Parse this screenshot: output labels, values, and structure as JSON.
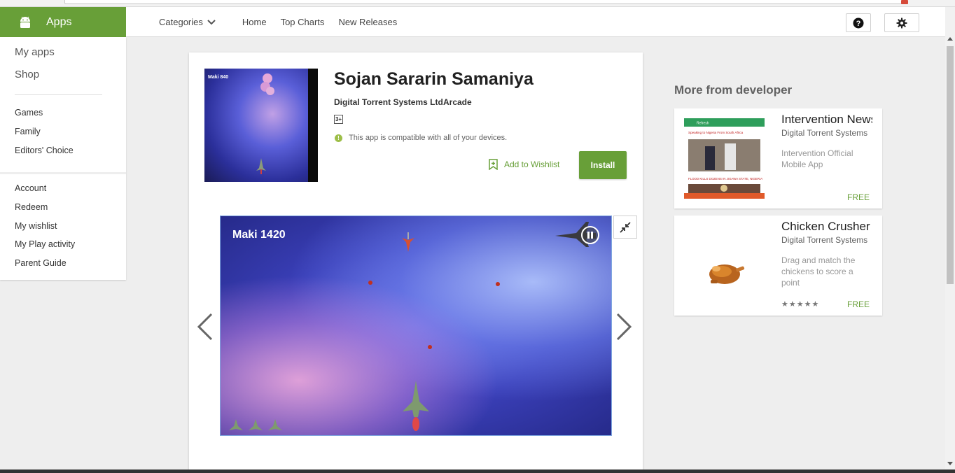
{
  "header": {
    "brand_label": "Apps",
    "nav": {
      "categories_label": "Categories",
      "home_label": "Home",
      "top_charts_label": "Top Charts",
      "new_releases_label": "New Releases"
    }
  },
  "sidebar": {
    "primary": [
      "My apps",
      "Shop"
    ],
    "browse": [
      "Games",
      "Family",
      "Editors' Choice"
    ],
    "account": [
      "Account",
      "Redeem",
      "My wishlist",
      "My Play activity",
      "Parent Guide"
    ]
  },
  "app": {
    "icon_text": "Maki 840",
    "title": "Sojan Sararin Samaniya",
    "developer": "Digital Torrent Systems Ltd",
    "genre": "Arcade",
    "content_rating": "3+",
    "compat_text": "This app is compatible with all of your devices.",
    "wishlist_label": "Add to Wishlist",
    "install_label": "Install"
  },
  "screenshot": {
    "score_label": "Maki",
    "score_value": "1420"
  },
  "more_from_developer": {
    "title": "More from developer",
    "items": [
      {
        "name": "Intervention News",
        "developer": "Digital Torrent Systems",
        "description": "Intervention Official Mobile App",
        "price": "FREE",
        "thumb_headline_1": "Speaking to Nigeria From South Africa",
        "thumb_headline_2": "FLOOD KILLS DOZENS IN JIGAWA STATE, NIGERIA",
        "thumb_appbar": "Refresh"
      },
      {
        "name": "Chicken Crusher",
        "developer": "Digital Torrent Systems",
        "description": "Drag and match the chickens to score a point",
        "price": "FREE",
        "rating_stars": "★★★★★"
      }
    ]
  },
  "colors": {
    "brand_green": "#689f38",
    "background": "#eeeeee"
  }
}
